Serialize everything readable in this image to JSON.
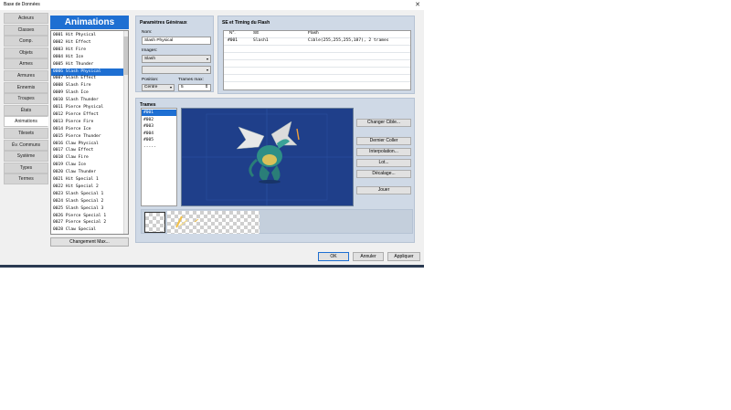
{
  "window": {
    "title": "Base de Données",
    "close_glyph": "✕"
  },
  "nav": {
    "items": [
      "Acteurs",
      "Classes",
      "Comp.",
      "Objets",
      "Armes",
      "Armures",
      "Ennemis",
      "Troupes",
      "États",
      "Animations",
      "Tilesets",
      "Év. Communs",
      "Système",
      "Types",
      "Termes"
    ],
    "active_index": 9
  },
  "animations": {
    "header": "Animations",
    "items": [
      "0001 Hit Physical",
      "0002 Hit Effect",
      "0003 Hit Fire",
      "0004 Hit Ice",
      "0005 Hit Thunder",
      "0006 Slash Physical",
      "0007 Slash Effect",
      "0008 Slash Fire",
      "0009 Slash Ice",
      "0010 Slash Thunder",
      "0011 Pierce Physical",
      "0012 Pierce Effect",
      "0013 Pierce Fire",
      "0014 Pierce Ice",
      "0015 Pierce Thunder",
      "0016 Claw Physical",
      "0017 Claw Effect",
      "0018 Claw Fire",
      "0019 Claw Ice",
      "0020 Claw Thunder",
      "0021 Hit Special 1",
      "0022 Hit Special 2",
      "0023 Slash Special 1",
      "0024 Slash Special 2",
      "0025 Slash Special 3",
      "0026 Pierce Special 1",
      "0027 Pierce Special 2",
      "0028 Claw Special"
    ],
    "selected_index": 5,
    "change_max_label": "Changement Max..."
  },
  "general": {
    "title": "Paramètres Généraux",
    "name_label": "Nom:",
    "name_value": "Slash Physical",
    "images_label": "Images:",
    "image1": "Slash",
    "image2": "",
    "position_label": "Position:",
    "position_value": "Centre",
    "max_frames_label": "Trames max:",
    "max_frames_value": "5"
  },
  "se": {
    "title": "SE et Timing du Flash",
    "columns": [
      "N°.",
      "SE",
      "Flash"
    ],
    "rows": [
      {
        "no": "#001",
        "se": "Slash1",
        "flash": "Cible(255,255,255,187), 2 trames"
      }
    ]
  },
  "frames": {
    "title": "Trames",
    "items": [
      "#001",
      "#002",
      "#003",
      "#004",
      "#005"
    ],
    "selected_index": 0,
    "end_marker": "-----"
  },
  "tools": {
    "change_target": "Changer Cible...",
    "paste_last": "Dernier Coller",
    "interpolation": "Interpolation...",
    "batch": "Lot...",
    "shift": "Décalage...",
    "play": "Jouer"
  },
  "footer": {
    "ok": "OK",
    "cancel": "Annuler",
    "apply": "Appliquer"
  },
  "colors": {
    "accent": "#1e6fd2",
    "canvas": "#1f3f8a",
    "panel": "#cfd9e6"
  },
  "icons": {
    "close": "close-icon",
    "dragon": "dragon-sprite"
  }
}
